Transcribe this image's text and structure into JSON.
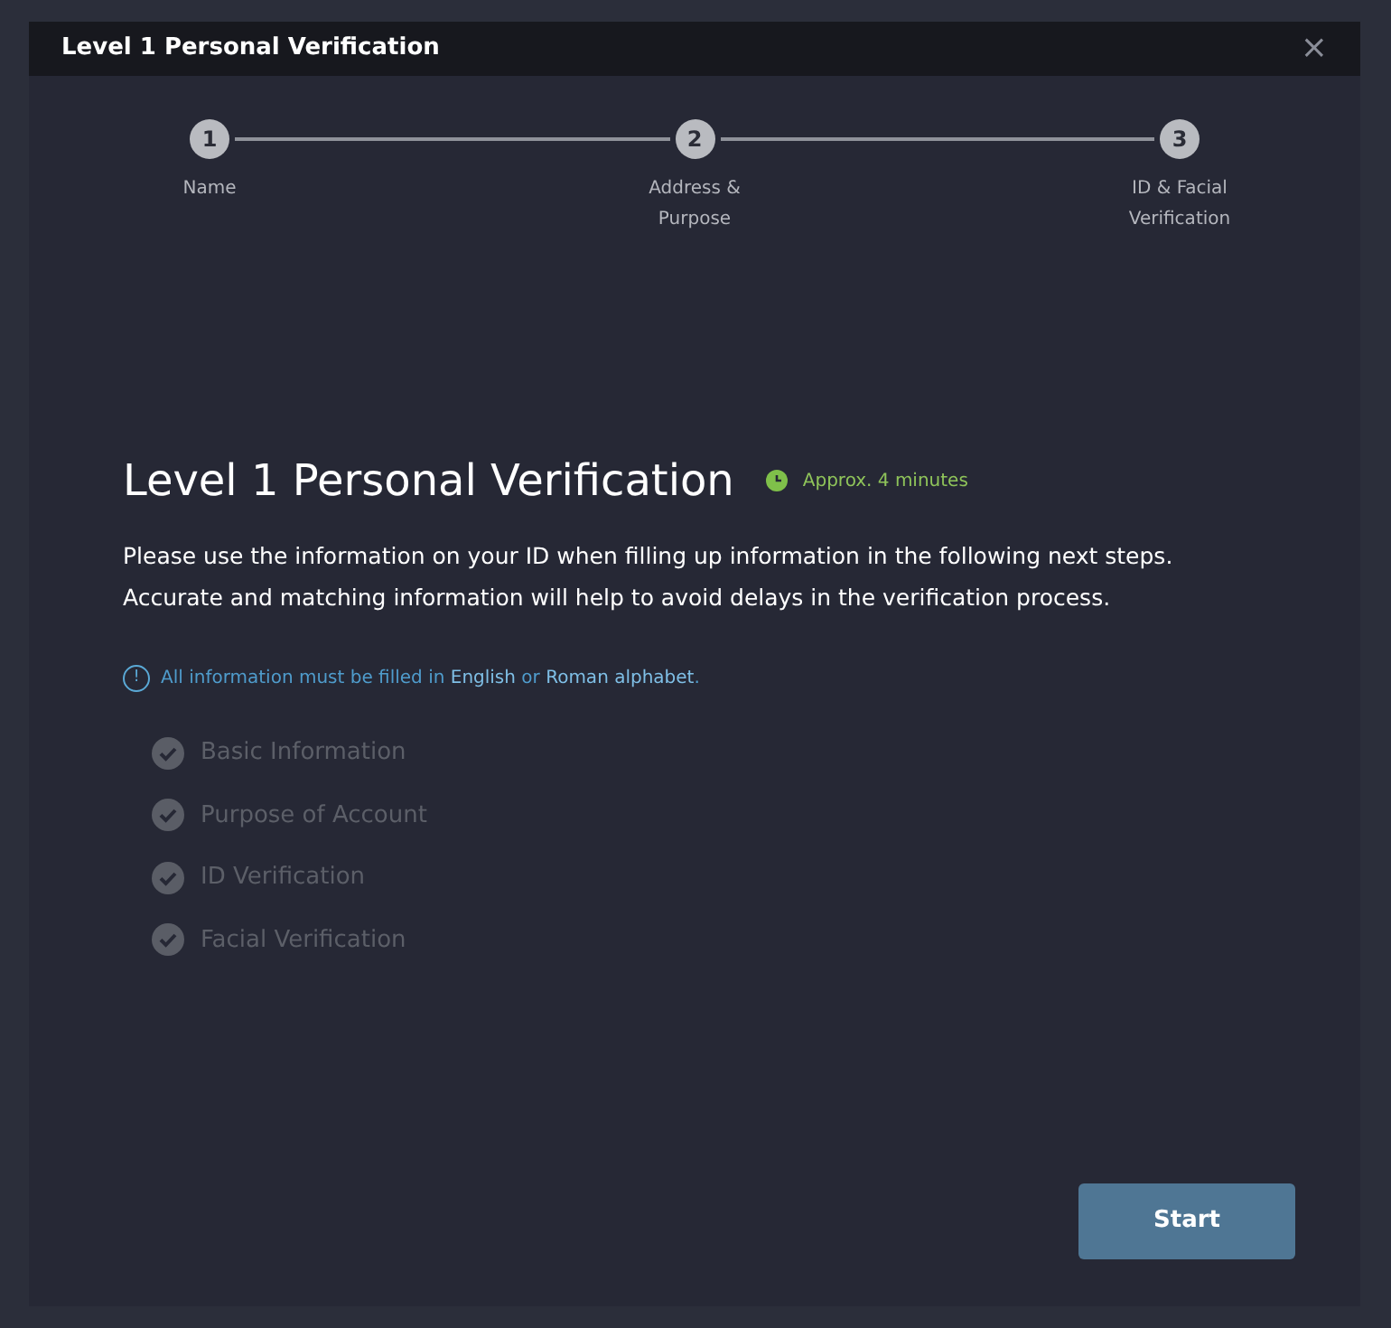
{
  "window": {
    "title": "Level 1 Personal Verification",
    "close": "×"
  },
  "steps": [
    {
      "number": "1",
      "label": "Name"
    },
    {
      "number": "2",
      "label": "Address & Purpose"
    },
    {
      "number": "3",
      "label": "ID & Facial Verification"
    }
  ],
  "heading": "Level 1 Personal Verification",
  "duration": "Approx. 4 minutes",
  "description": [
    "Please use the information on your ID when filling up information in the following next steps.",
    "Accurate and matching information will help to avoid delays in the verification process."
  ],
  "notice": {
    "icon": "!",
    "parts": [
      {
        "text": "All information must be filled in ",
        "kind": "plain"
      },
      {
        "text": "English",
        "kind": "link"
      },
      {
        "text": " or ",
        "kind": "plain"
      },
      {
        "text": "Roman alphabet",
        "kind": "link"
      },
      {
        "text": ".",
        "kind": "plain"
      }
    ]
  },
  "checklist": [
    "Basic Information",
    "Purpose of Account",
    "ID Verification",
    "Facial Verification"
  ],
  "start_button": "Start"
}
